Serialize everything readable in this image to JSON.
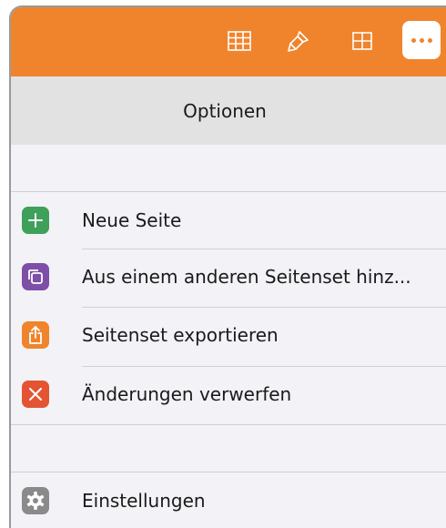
{
  "toolbar": {
    "background": "#f0842c",
    "icons": [
      "table-grid-icon",
      "paintbrush-icon",
      "grid-icon",
      "more-icon"
    ]
  },
  "header": {
    "title": "Optionen"
  },
  "menu": {
    "items": [
      {
        "label": "Neue Seite",
        "icon": "plus-icon",
        "color": "#3fa05a"
      },
      {
        "label": "Aus einem anderen Seitenset hinz...",
        "icon": "copy-pages-icon",
        "color": "#7e4fa6"
      },
      {
        "label": "Seitenset exportieren",
        "icon": "share-icon",
        "color": "#f0842c"
      },
      {
        "label": "Änderungen verwerfen",
        "icon": "close-icon",
        "color": "#e45433"
      }
    ],
    "settings": {
      "label": "Einstellungen",
      "icon": "gear-icon",
      "color": "#8a8a8a"
    }
  }
}
